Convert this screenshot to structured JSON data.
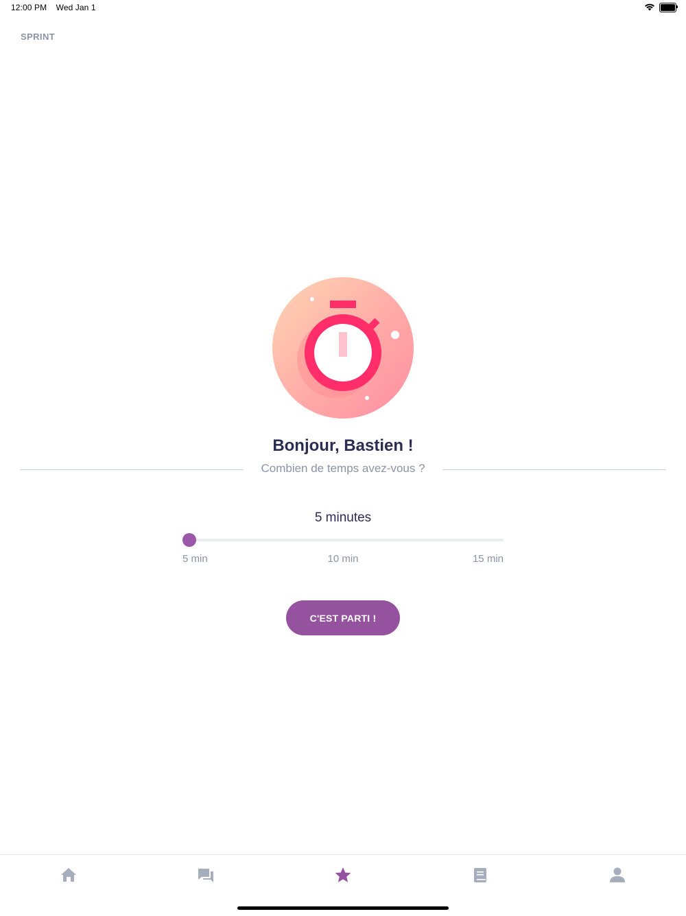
{
  "status_bar": {
    "time": "12:00 PM",
    "date": "Wed Jan 1"
  },
  "header": {
    "title": "SPRINT"
  },
  "main": {
    "greeting": "Bonjour, Bastien !",
    "question": "Combien de temps avez-vous ?",
    "duration_value": "5 minutes",
    "slider": {
      "min_label": "5 min",
      "mid_label": "10 min",
      "max_label": "15 min",
      "level": 0
    },
    "cta_label": "C'EST PARTI !"
  },
  "tab_bar": {
    "tabs": [
      {
        "icon": "home-icon",
        "active": false
      },
      {
        "icon": "chat-icon",
        "active": false
      },
      {
        "icon": "star-icon",
        "active": true
      },
      {
        "icon": "book-icon",
        "active": false
      },
      {
        "icon": "profile-icon",
        "active": false
      }
    ]
  },
  "colors": {
    "accent": "#95529f",
    "tab_inactive": "#a6adbd",
    "timer_red": "#ff2d6a",
    "text_dark": "#2b2d52",
    "text_muted": "#8a94a6"
  }
}
